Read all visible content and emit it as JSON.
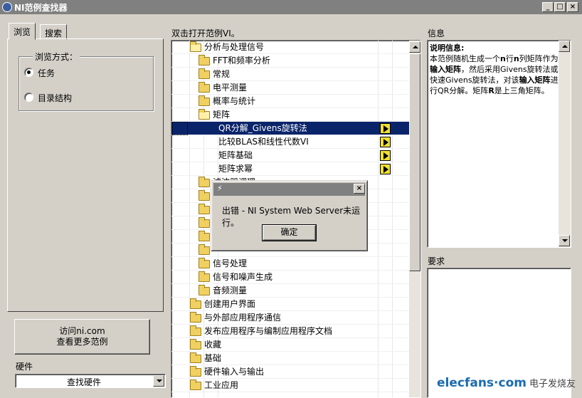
{
  "window": {
    "title": "NI范例查找器"
  },
  "left": {
    "tabs": [
      {
        "label": "浏览",
        "active": true
      },
      {
        "label": "搜索",
        "active": false
      }
    ],
    "browse_mode_label": "浏览方式：",
    "radios": [
      {
        "label": "任务",
        "checked": true
      },
      {
        "label": "目录结构",
        "checked": false
      }
    ],
    "visit_button": {
      "line1": "访问ni.com",
      "line2": "查看更多范例"
    },
    "hardware_label": "硬件",
    "hardware_select_value": "查找硬件"
  },
  "list": {
    "header": "双击打开范例VI。",
    "rows": [
      {
        "label": "分析与处理信号",
        "kind": "folder-open",
        "level": 1
      },
      {
        "label": "FFT和频率分析",
        "kind": "folder",
        "level": 2
      },
      {
        "label": "常规",
        "kind": "folder",
        "level": 2
      },
      {
        "label": "电平测量",
        "kind": "folder",
        "level": 2
      },
      {
        "label": "概率与统计",
        "kind": "folder",
        "level": 2
      },
      {
        "label": "矩阵",
        "kind": "folder-open",
        "level": 2
      },
      {
        "label": "QR分解_Givens旋转法",
        "kind": "vi",
        "level": 3,
        "selected": true
      },
      {
        "label": "比较BLAS和线性代数VI",
        "kind": "vi",
        "level": 3
      },
      {
        "label": "矩阵基础",
        "kind": "vi",
        "level": 3
      },
      {
        "label": "矩阵求幂",
        "kind": "vi",
        "level": 3
      },
      {
        "label": "滤波器调理",
        "kind": "folder",
        "level": 2
      },
      {
        "label": "",
        "kind": "folder",
        "level": 2
      },
      {
        "label": "",
        "kind": "folder",
        "level": 2
      },
      {
        "label": "",
        "kind": "folder",
        "level": 2
      },
      {
        "label": "",
        "kind": "folder",
        "level": 2
      },
      {
        "label": "",
        "kind": "folder",
        "level": 2
      },
      {
        "label": "信号处理",
        "kind": "folder",
        "level": 2
      },
      {
        "label": "信号和噪声生成",
        "kind": "folder",
        "level": 2
      },
      {
        "label": "音频测量",
        "kind": "folder",
        "level": 2
      },
      {
        "label": "创建用户界面",
        "kind": "folder",
        "level": 1
      },
      {
        "label": "与外部应用程序通信",
        "kind": "folder",
        "level": 1
      },
      {
        "label": "发布应用程序与编制应用程序文档",
        "kind": "folder",
        "level": 1
      },
      {
        "label": "收藏",
        "kind": "folder",
        "level": 1
      },
      {
        "label": "基础",
        "kind": "folder",
        "level": 1
      },
      {
        "label": "硬件输入与输出",
        "kind": "folder",
        "level": 1
      },
      {
        "label": "工业应用",
        "kind": "folder",
        "level": 1
      }
    ]
  },
  "dialog": {
    "message": "出错 - NI System Web Server未运行。",
    "ok_label": "确定"
  },
  "info": {
    "label": "信息",
    "heading": "说明信息:",
    "text_parts": [
      {
        "t": "本范例随机生成一个",
        "b": false
      },
      {
        "t": "n",
        "b": true
      },
      {
        "t": "行",
        "b": false
      },
      {
        "t": "n",
        "b": true
      },
      {
        "t": "列矩阵作为",
        "b": false
      },
      {
        "t": "输入矩阵",
        "b": true
      },
      {
        "t": "，然后采用Givens旋转法或快速Givens旋转法，对该",
        "b": false
      },
      {
        "t": "输入矩阵",
        "b": true
      },
      {
        "t": "进行QR分解。矩阵",
        "b": false
      },
      {
        "t": "R",
        "b": true
      },
      {
        "t": "是上三角矩阵。",
        "b": false
      }
    ]
  },
  "requirements": {
    "label": "要求"
  },
  "watermark": {
    "site": "elecfans·com",
    "cn": "电子发烧友"
  }
}
